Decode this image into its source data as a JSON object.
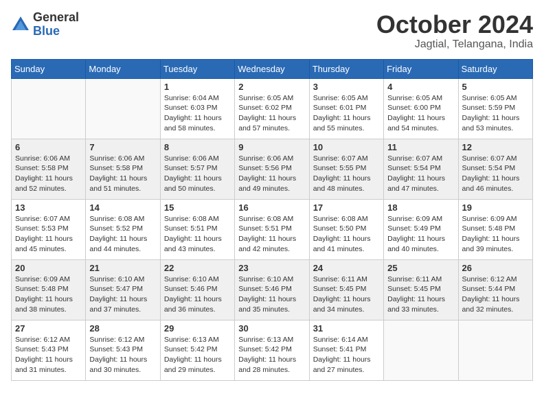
{
  "header": {
    "logo": {
      "text_general": "General",
      "text_blue": "Blue"
    },
    "month": "October 2024",
    "location": "Jagtial, Telangana, India"
  },
  "weekdays": [
    "Sunday",
    "Monday",
    "Tuesday",
    "Wednesday",
    "Thursday",
    "Friday",
    "Saturday"
  ],
  "weeks": [
    [
      {
        "day": "",
        "sunrise": "",
        "sunset": "",
        "daylight": ""
      },
      {
        "day": "",
        "sunrise": "",
        "sunset": "",
        "daylight": ""
      },
      {
        "day": "1",
        "sunrise": "Sunrise: 6:04 AM",
        "sunset": "Sunset: 6:03 PM",
        "daylight": "Daylight: 11 hours and 58 minutes."
      },
      {
        "day": "2",
        "sunrise": "Sunrise: 6:05 AM",
        "sunset": "Sunset: 6:02 PM",
        "daylight": "Daylight: 11 hours and 57 minutes."
      },
      {
        "day": "3",
        "sunrise": "Sunrise: 6:05 AM",
        "sunset": "Sunset: 6:01 PM",
        "daylight": "Daylight: 11 hours and 55 minutes."
      },
      {
        "day": "4",
        "sunrise": "Sunrise: 6:05 AM",
        "sunset": "Sunset: 6:00 PM",
        "daylight": "Daylight: 11 hours and 54 minutes."
      },
      {
        "day": "5",
        "sunrise": "Sunrise: 6:05 AM",
        "sunset": "Sunset: 5:59 PM",
        "daylight": "Daylight: 11 hours and 53 minutes."
      }
    ],
    [
      {
        "day": "6",
        "sunrise": "Sunrise: 6:06 AM",
        "sunset": "Sunset: 5:58 PM",
        "daylight": "Daylight: 11 hours and 52 minutes."
      },
      {
        "day": "7",
        "sunrise": "Sunrise: 6:06 AM",
        "sunset": "Sunset: 5:58 PM",
        "daylight": "Daylight: 11 hours and 51 minutes."
      },
      {
        "day": "8",
        "sunrise": "Sunrise: 6:06 AM",
        "sunset": "Sunset: 5:57 PM",
        "daylight": "Daylight: 11 hours and 50 minutes."
      },
      {
        "day": "9",
        "sunrise": "Sunrise: 6:06 AM",
        "sunset": "Sunset: 5:56 PM",
        "daylight": "Daylight: 11 hours and 49 minutes."
      },
      {
        "day": "10",
        "sunrise": "Sunrise: 6:07 AM",
        "sunset": "Sunset: 5:55 PM",
        "daylight": "Daylight: 11 hours and 48 minutes."
      },
      {
        "day": "11",
        "sunrise": "Sunrise: 6:07 AM",
        "sunset": "Sunset: 5:54 PM",
        "daylight": "Daylight: 11 hours and 47 minutes."
      },
      {
        "day": "12",
        "sunrise": "Sunrise: 6:07 AM",
        "sunset": "Sunset: 5:54 PM",
        "daylight": "Daylight: 11 hours and 46 minutes."
      }
    ],
    [
      {
        "day": "13",
        "sunrise": "Sunrise: 6:07 AM",
        "sunset": "Sunset: 5:53 PM",
        "daylight": "Daylight: 11 hours and 45 minutes."
      },
      {
        "day": "14",
        "sunrise": "Sunrise: 6:08 AM",
        "sunset": "Sunset: 5:52 PM",
        "daylight": "Daylight: 11 hours and 44 minutes."
      },
      {
        "day": "15",
        "sunrise": "Sunrise: 6:08 AM",
        "sunset": "Sunset: 5:51 PM",
        "daylight": "Daylight: 11 hours and 43 minutes."
      },
      {
        "day": "16",
        "sunrise": "Sunrise: 6:08 AM",
        "sunset": "Sunset: 5:51 PM",
        "daylight": "Daylight: 11 hours and 42 minutes."
      },
      {
        "day": "17",
        "sunrise": "Sunrise: 6:08 AM",
        "sunset": "Sunset: 5:50 PM",
        "daylight": "Daylight: 11 hours and 41 minutes."
      },
      {
        "day": "18",
        "sunrise": "Sunrise: 6:09 AM",
        "sunset": "Sunset: 5:49 PM",
        "daylight": "Daylight: 11 hours and 40 minutes."
      },
      {
        "day": "19",
        "sunrise": "Sunrise: 6:09 AM",
        "sunset": "Sunset: 5:48 PM",
        "daylight": "Daylight: 11 hours and 39 minutes."
      }
    ],
    [
      {
        "day": "20",
        "sunrise": "Sunrise: 6:09 AM",
        "sunset": "Sunset: 5:48 PM",
        "daylight": "Daylight: 11 hours and 38 minutes."
      },
      {
        "day": "21",
        "sunrise": "Sunrise: 6:10 AM",
        "sunset": "Sunset: 5:47 PM",
        "daylight": "Daylight: 11 hours and 37 minutes."
      },
      {
        "day": "22",
        "sunrise": "Sunrise: 6:10 AM",
        "sunset": "Sunset: 5:46 PM",
        "daylight": "Daylight: 11 hours and 36 minutes."
      },
      {
        "day": "23",
        "sunrise": "Sunrise: 6:10 AM",
        "sunset": "Sunset: 5:46 PM",
        "daylight": "Daylight: 11 hours and 35 minutes."
      },
      {
        "day": "24",
        "sunrise": "Sunrise: 6:11 AM",
        "sunset": "Sunset: 5:45 PM",
        "daylight": "Daylight: 11 hours and 34 minutes."
      },
      {
        "day": "25",
        "sunrise": "Sunrise: 6:11 AM",
        "sunset": "Sunset: 5:45 PM",
        "daylight": "Daylight: 11 hours and 33 minutes."
      },
      {
        "day": "26",
        "sunrise": "Sunrise: 6:12 AM",
        "sunset": "Sunset: 5:44 PM",
        "daylight": "Daylight: 11 hours and 32 minutes."
      }
    ],
    [
      {
        "day": "27",
        "sunrise": "Sunrise: 6:12 AM",
        "sunset": "Sunset: 5:43 PM",
        "daylight": "Daylight: 11 hours and 31 minutes."
      },
      {
        "day": "28",
        "sunrise": "Sunrise: 6:12 AM",
        "sunset": "Sunset: 5:43 PM",
        "daylight": "Daylight: 11 hours and 30 minutes."
      },
      {
        "day": "29",
        "sunrise": "Sunrise: 6:13 AM",
        "sunset": "Sunset: 5:42 PM",
        "daylight": "Daylight: 11 hours and 29 minutes."
      },
      {
        "day": "30",
        "sunrise": "Sunrise: 6:13 AM",
        "sunset": "Sunset: 5:42 PM",
        "daylight": "Daylight: 11 hours and 28 minutes."
      },
      {
        "day": "31",
        "sunrise": "Sunrise: 6:14 AM",
        "sunset": "Sunset: 5:41 PM",
        "daylight": "Daylight: 11 hours and 27 minutes."
      },
      {
        "day": "",
        "sunrise": "",
        "sunset": "",
        "daylight": ""
      },
      {
        "day": "",
        "sunrise": "",
        "sunset": "",
        "daylight": ""
      }
    ]
  ]
}
